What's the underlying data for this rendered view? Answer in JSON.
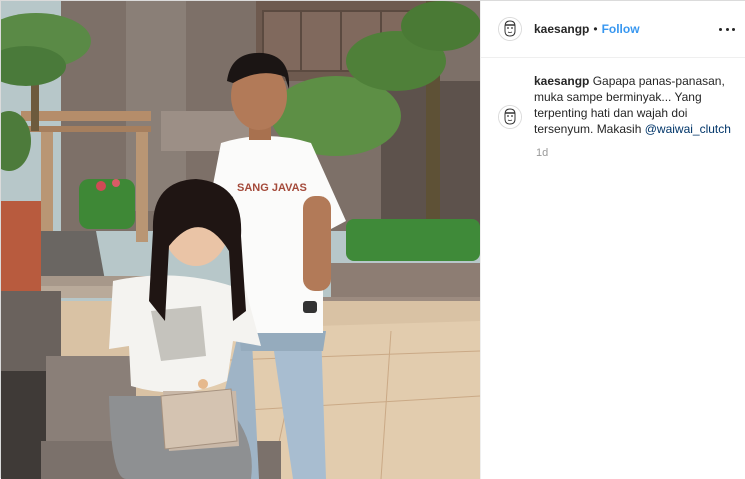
{
  "post": {
    "username": "kaesangp",
    "separator": "•",
    "follow_label": "Follow",
    "more_icon": "more-options-icon"
  },
  "comment": {
    "username": "kaesangp",
    "text": "Gapapa panas-panasan, muka sampe berminyak... Yang terpenting hati dan wajah doi tersenyum. Makasih",
    "mention": "@waiwai_clutch",
    "timestamp": "1d"
  },
  "photo": {
    "shirt_print": "SANG JAVAS"
  },
  "colors": {
    "accent": "#3897f0",
    "mention": "#003569",
    "text": "#262626",
    "muted": "#999999"
  }
}
